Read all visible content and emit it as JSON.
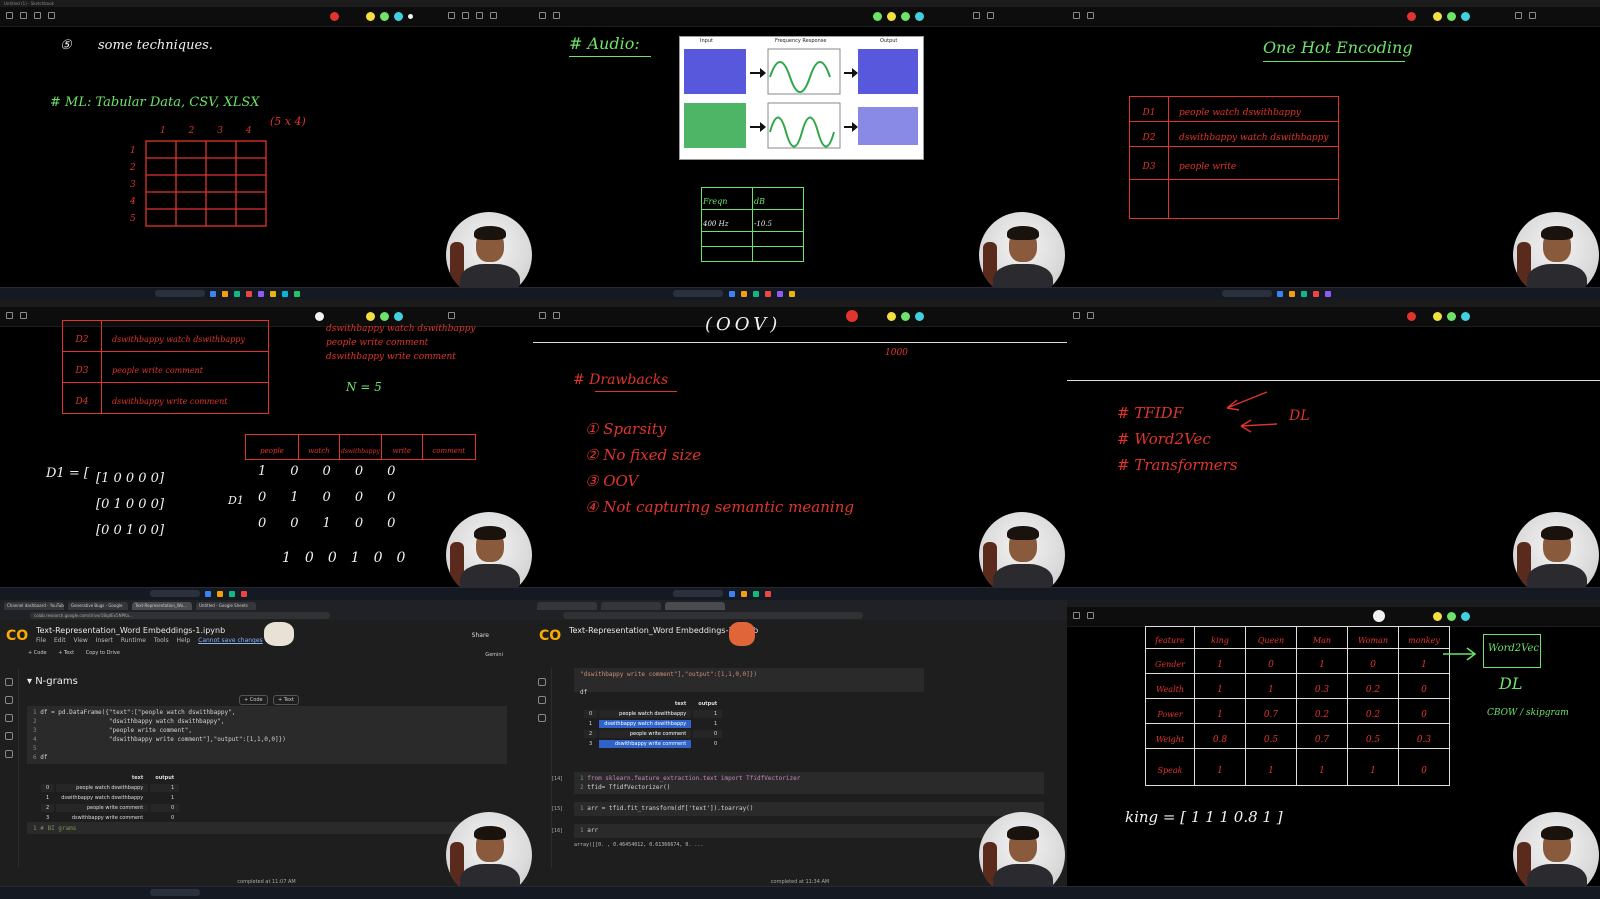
{
  "tile1": {
    "window_title": "Untitled (1) - Sketchbook",
    "lines": [
      {
        "num": "⑤",
        "text": "some techniques."
      },
      {
        "text": "# ML: Tabular Data, CSV, XLSX"
      },
      {
        "dims": "(5 x 4)"
      }
    ],
    "col_headers": [
      "1",
      "2",
      "3",
      "4"
    ],
    "row_headers": [
      "1",
      "2",
      "3",
      "4",
      "5"
    ]
  },
  "tile2": {
    "heading": "# Audio:",
    "figure_labels": {
      "input": "Input",
      "freq": "Frequency Response",
      "output": "Output"
    },
    "table_header": [
      "Freqn",
      "dB"
    ],
    "table_row": [
      "400 Hz",
      "-10.5"
    ]
  },
  "tile3": {
    "heading": "One Hot Encoding",
    "rows": [
      {
        "id": "D1",
        "text": "people watch dswithbappy"
      },
      {
        "id": "D2",
        "text": "dswithbappy watch dswithbappy"
      },
      {
        "id": "D3",
        "text": "people write"
      }
    ]
  },
  "tile4": {
    "rows": [
      {
        "id": "D2",
        "text": "dswithbappy watch dswithbappy"
      },
      {
        "id": "D3",
        "text": "people write comment"
      },
      {
        "id": "D4",
        "text": "dswithbappy write comment"
      }
    ],
    "vocab_notes": [
      "dswithbappy watch dswithbappy",
      "people write comment",
      "dswithbappy write comment"
    ],
    "n_label": "N = 5",
    "vocab_header": [
      "people",
      "watch",
      "dswithbappy",
      "write",
      "comment"
    ],
    "vector_label": "D1 = [",
    "vectors": [
      "[1 0 0 0 0]",
      "[0 1 0 0 0]",
      "[0 0 1 0 0]"
    ],
    "d1_label": "D1",
    "matrix": [
      [
        "1",
        "0",
        "0",
        "0",
        "0"
      ],
      [
        "0",
        "1",
        "0",
        "0",
        "0"
      ],
      [
        "0",
        "0",
        "1",
        "0",
        "0"
      ]
    ],
    "last_row": [
      "1",
      "0",
      "0",
      "1",
      "0",
      "0"
    ]
  },
  "tile5": {
    "oov": "(OOV)",
    "right_num": "1000",
    "heading": "# Drawbacks",
    "items": [
      "① Sparsity",
      "② No fixed size",
      "③ OOV",
      "④ Not capturing semantic meaning"
    ]
  },
  "tile6": {
    "items": [
      "# TFIDF",
      "# Word2Vec",
      "# Transformers"
    ],
    "arrow_label": "DL"
  },
  "tile7": {
    "tabs": [
      "Channel dashboard - YouTube",
      "Generative Bugs - Google",
      "Text-Representation_Wo...",
      "Untitled - Google Sheets"
    ],
    "url": "colab.research.google.com/drive/1Bq4Ex5NPKa...",
    "notebook_title": "Text-Representation_Word Embeddings-1.ipynb",
    "menu": [
      "File",
      "Edit",
      "View",
      "Insert",
      "Runtime",
      "Tools",
      "Help"
    ],
    "cannot_save": "Cannot save changes",
    "cell_buttons": [
      "+ Code",
      "+ Text",
      "Copy to Drive"
    ],
    "share": "Share",
    "gemini": "Gemini",
    "section": "N-grams",
    "add_code": "+ Code",
    "add_text": "+ Text",
    "code_lines": [
      "df = pd.DataFrame({\"text\":[\"people watch dswithbappy\",",
      "                   \"dswithbappy watch dswithbappy\",",
      "                   \"people write comment\",",
      "                   \"dswithbappy write comment\"],\"output\":[1,1,0,0]})",
      "",
      "df"
    ],
    "df_cols": [
      "text",
      "output"
    ],
    "df_rows": [
      [
        "0",
        "people watch dswithbappy",
        "1"
      ],
      [
        "1",
        "dswithbappy watch dswithbappy",
        "1"
      ],
      [
        "2",
        "people write comment",
        "0"
      ],
      [
        "3",
        "dswithbappy write comment",
        "0"
      ]
    ],
    "next_cell": "# BI grams",
    "status": "completed at 11:07 AM"
  },
  "tile8": {
    "notebook_title": "Text-Representation_Word Embeddings-1.ipynb",
    "code_top": [
      "\"dswithbappy write comment\"],\"output\":[1,1,0,0]})",
      "",
      "df"
    ],
    "df_cols": [
      "text",
      "output"
    ],
    "df_rows": [
      [
        "0",
        "people watch dswithbappy",
        "1"
      ],
      [
        "1",
        "dswithbappy watch dswithbappy",
        "1"
      ],
      [
        "2",
        "people write comment",
        "0"
      ],
      [
        "3",
        "dswithbappy write comment",
        "0"
      ]
    ],
    "cell14_num": "[14]",
    "cell14": [
      "from sklearn.feature_extraction.text import TfidfVectorizer",
      "tfid= TfidfVectorizer()"
    ],
    "cell15_num": "[15]",
    "cell15": "arr = tfid.fit_transform(df['text']).toarray()",
    "cell16_num": "[16]",
    "cell16": "arr",
    "output_line": "array([[0.        , 0.46454012, 0.61366674, 0.        ...",
    "status": "completed at 11:34 AM"
  },
  "tile9": {
    "headers": [
      "feature",
      "king",
      "Queen",
      "Man",
      "Woman",
      "monkey"
    ],
    "rows": [
      {
        "label": "Gender",
        "values": [
          "1",
          "0",
          "1",
          "0",
          "1"
        ]
      },
      {
        "label": "Wealth",
        "values": [
          "1",
          "1",
          "0.3",
          "0.2",
          "0"
        ]
      },
      {
        "label": "Power",
        "values": [
          "1",
          "0.7",
          "0.2",
          "0.2",
          "0"
        ]
      },
      {
        "label": "Weight",
        "values": [
          "0.8",
          "0.5",
          "0.7",
          "0.5",
          "0.3"
        ]
      },
      {
        "label": "Speak",
        "values": [
          "1",
          "1",
          "1",
          "1",
          "0"
        ]
      }
    ],
    "right_box": "Word2Vec",
    "right_dl": "DL",
    "right_note": "CBOW / skipgram",
    "king_vec": "king = [ 1  1  1  0.8  1 ]"
  }
}
